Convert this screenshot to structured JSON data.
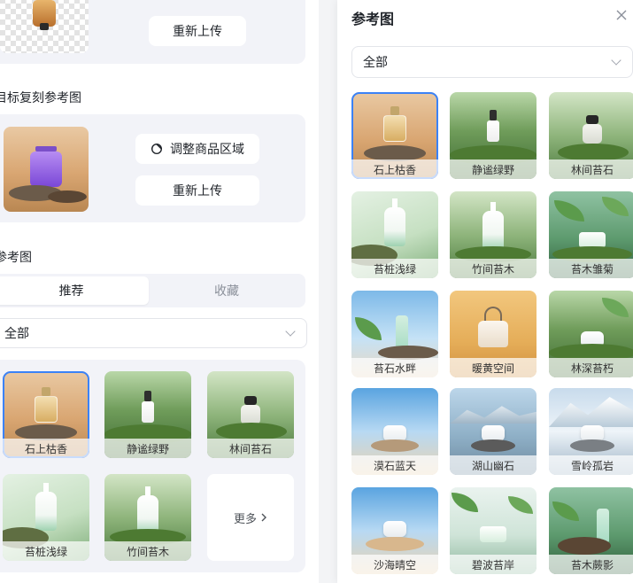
{
  "left": {
    "top_reupload_label": "重新上传",
    "section_copy_title": "目标复刻参考图",
    "adjust_region_label": "调整商品区域",
    "reupload_label": "重新上传",
    "section_ref_title": "参考图",
    "tabs": [
      {
        "label": "推荐",
        "active": true
      },
      {
        "label": "收藏",
        "active": false
      }
    ],
    "category_select": {
      "value": "全部"
    },
    "items": [
      {
        "label": "石上枯香",
        "scene": "warm",
        "product": "perfume",
        "selected": true
      },
      {
        "label": "静谧绿野",
        "scene": "forest",
        "product": "dropper",
        "selected": false
      },
      {
        "label": "林间苔石",
        "scene": "forest2",
        "product": "perfume-dark",
        "selected": false
      },
      {
        "label": "苔桩浅绿",
        "scene": "mint",
        "product": "bottle",
        "selected": false
      },
      {
        "label": "竹间苔木",
        "scene": "forest2",
        "product": "bottle",
        "selected": false
      }
    ],
    "more_label": "更多"
  },
  "right": {
    "title": "参考图",
    "category_select": {
      "value": "全部"
    },
    "items": [
      {
        "label": "石上枯香",
        "scene": "warm",
        "product": "perfume",
        "selected": true
      },
      {
        "label": "静谧绿野",
        "scene": "forest",
        "product": "dropper",
        "selected": false
      },
      {
        "label": "林间苔石",
        "scene": "forest2",
        "product": "perfume-dark",
        "selected": false
      },
      {
        "label": "苔桩浅绿",
        "scene": "mint",
        "product": "bottle",
        "selected": false
      },
      {
        "label": "竹间苔木",
        "scene": "forest2",
        "product": "bottle",
        "selected": false
      },
      {
        "label": "苔木雏菊",
        "scene": "fern",
        "product": "jar",
        "selected": false
      },
      {
        "label": "苔石水畔",
        "scene": "sky",
        "product": "tube",
        "selected": false
      },
      {
        "label": "暖黄空间",
        "scene": "amber",
        "product": "bag",
        "selected": false
      },
      {
        "label": "林深苔朽",
        "scene": "forest",
        "product": "pods",
        "selected": false
      },
      {
        "label": "漠石蓝天",
        "scene": "beach",
        "product": "pods",
        "selected": false
      },
      {
        "label": "湖山幽石",
        "scene": "lake",
        "product": "pods",
        "selected": false
      },
      {
        "label": "雪岭孤岩",
        "scene": "snow",
        "product": "pods",
        "selected": false
      },
      {
        "label": "沙海晴空",
        "scene": "beach",
        "product": "pods",
        "selected": false
      },
      {
        "label": "碧波苔岸",
        "scene": "pale",
        "product": "jar",
        "selected": false
      },
      {
        "label": "苔木蕨影",
        "scene": "fern",
        "product": "tube",
        "selected": false
      }
    ]
  },
  "colors": {
    "accent": "#3b82f6",
    "panel_bg": "#f2f3f8"
  },
  "icons": {
    "adjust": "cube-icon",
    "chevron": "chevron-down-icon",
    "close": "close-icon",
    "more": "chevron-right-icon"
  }
}
